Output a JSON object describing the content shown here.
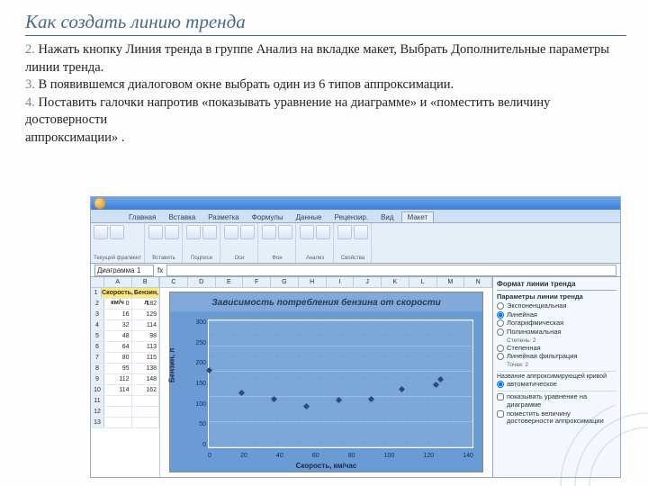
{
  "title": "Как создать линию тренда",
  "bullets": {
    "n2": "2.",
    "t2": "Нажать кнопку Линия тренда в группе Анализ на вкладке макет, Выбрать Дополнительные параметры линии тренда.",
    "n3": "3.",
    "t3": "В появившемся диалоговом окне выбрать один из 6 типов аппроксимации.",
    "n4": "4.",
    "t4": "Поставить галочки напротив «показывать уравнение на диаграмме» и «поместить величину достоверности",
    "tail": "аппроксимации» ."
  },
  "excel": {
    "tabs": [
      "Главная",
      "Вставка",
      "Разметка",
      "Формулы",
      "Данные",
      "Рецензир.",
      "Вид",
      "Макет"
    ],
    "active_tab": "Макет",
    "namebox": "Диаграмма 1",
    "ribbon_groups": [
      "Текущий фрагмент",
      "Вставить",
      "Подписи",
      "Оси",
      "Фон",
      "Анализ",
      "Свойства"
    ],
    "col_headers": [
      "A",
      "B"
    ],
    "header_row": [
      "Скорость, км/ч",
      "Бензин, л"
    ],
    "rows": [
      [
        "0",
        "182"
      ],
      [
        "16",
        "129"
      ],
      [
        "32",
        "114"
      ],
      [
        "48",
        "98"
      ],
      [
        "64",
        "113"
      ],
      [
        "80",
        "115"
      ],
      [
        "95",
        "138"
      ],
      [
        "112",
        "148"
      ],
      [
        "114",
        "162"
      ],
      [
        "",
        ""
      ],
      [
        "",
        ""
      ],
      [
        "",
        ""
      ]
    ],
    "chart_cols": [
      "C",
      "D",
      "E",
      "F",
      "G",
      "H",
      "I",
      "J",
      "K",
      "L",
      "M",
      "N"
    ],
    "panel": {
      "title": "Формат линии тренда",
      "section": "Параметры линии тренда",
      "opts": [
        "Экспоненциальная",
        "Линейная",
        "Логарифмическая",
        "Полиномиальная",
        "Степенная",
        "Линейная фильтрация"
      ],
      "sub_poly": "Степень: 2",
      "sub_filter": "Точки: 2",
      "extra1": "Название аппроксимирующей кривой",
      "extra2": "автоматическое",
      "chk1": "показывать уравнение на диаграмме",
      "chk2": "поместить величину достоверности аппроксимации"
    }
  },
  "chart_data": {
    "type": "scatter",
    "title": "Зависимость потребления бензина от скорости",
    "xlabel": "Скорость, км/час",
    "ylabel": "Бензин, л",
    "x": [
      0,
      16,
      32,
      48,
      64,
      80,
      95,
      112,
      114
    ],
    "y": [
      182,
      129,
      114,
      98,
      113,
      115,
      138,
      148,
      162
    ],
    "xlim": [
      0,
      130
    ],
    "ylim": [
      0,
      300
    ],
    "yticks": [
      300,
      250,
      200,
      150,
      100,
      50,
      0
    ],
    "xticks": [
      0,
      20,
      40,
      60,
      80,
      100,
      120,
      140
    ]
  }
}
